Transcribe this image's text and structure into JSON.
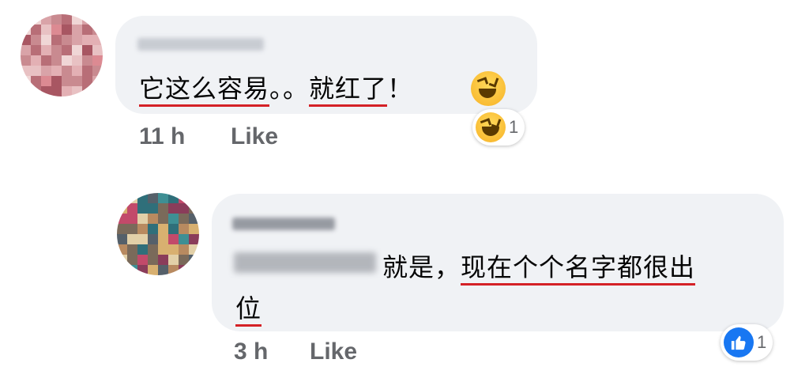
{
  "comments": [
    {
      "message_parts": [
        "它这么容易",
        "。。",
        "就红了",
        "！"
      ],
      "time": "11 h",
      "like_label": "Like",
      "reaction": {
        "icon": "haha-reaction-icon",
        "count": "1"
      }
    },
    {
      "message_parts": [
        "就是，",
        "现在个个名字都很出",
        "位"
      ],
      "time": "3 h",
      "like_label": "Like",
      "reaction": {
        "icon": "like-reaction-icon",
        "count": "1"
      }
    }
  ],
  "colors": {
    "bubble": "#f0f2f5",
    "underline": "#d42126",
    "meta_text": "#65676b",
    "like_blue": "#1877f2"
  }
}
